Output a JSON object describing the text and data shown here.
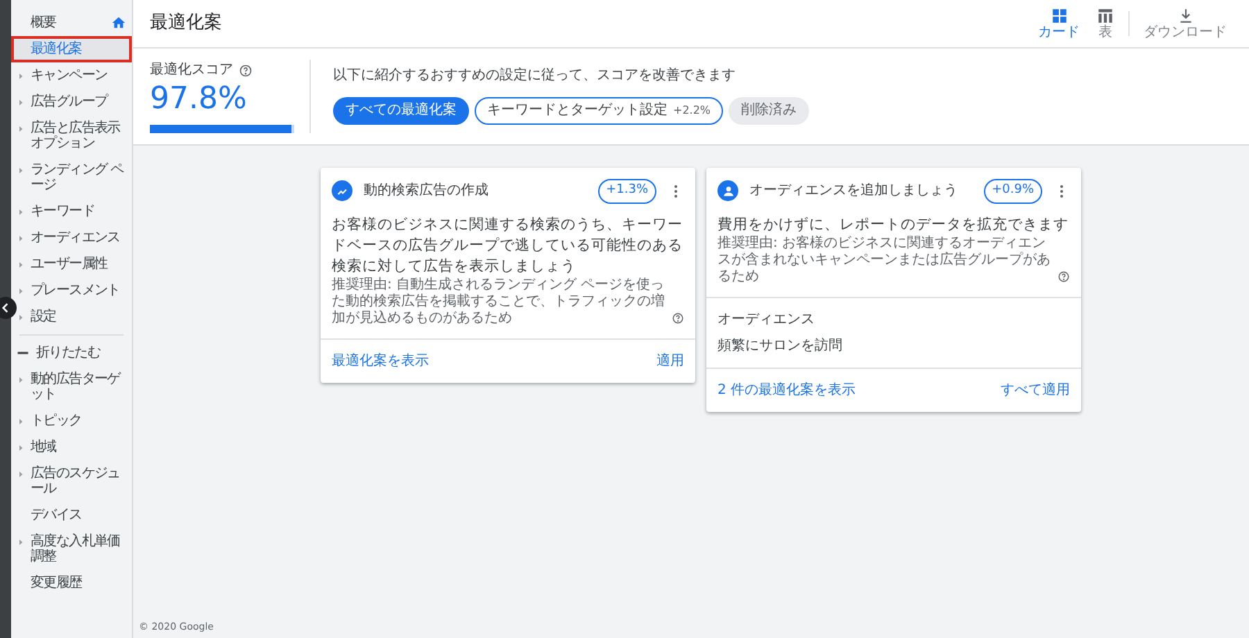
{
  "sidebar": {
    "items": [
      {
        "label": "概要",
        "kind": "home",
        "selected": false
      },
      {
        "label": "最適化案",
        "kind": "plain",
        "selected": true
      },
      {
        "label": "キャンペーン",
        "kind": "expandable",
        "selected": false
      },
      {
        "label": "広告グループ",
        "kind": "expandable",
        "selected": false
      },
      {
        "label": "広告と広告表示オプション",
        "kind": "expandable",
        "selected": false
      },
      {
        "label": "ランディング ページ",
        "kind": "expandable",
        "selected": false
      },
      {
        "label": "キーワード",
        "kind": "expandable",
        "selected": false
      },
      {
        "label": "オーディエンス",
        "kind": "expandable",
        "selected": false
      },
      {
        "label": "ユーザー属性",
        "kind": "expandable",
        "selected": false
      },
      {
        "label": "プレースメント",
        "kind": "expandable",
        "selected": false
      },
      {
        "label": "設定",
        "kind": "expandable",
        "selected": false
      },
      {
        "label": "折りたたむ",
        "kind": "collapse",
        "selected": false
      },
      {
        "label": "動的広告ターゲット",
        "kind": "expandable",
        "selected": false
      },
      {
        "label": "トピック",
        "kind": "expandable",
        "selected": false
      },
      {
        "label": "地域",
        "kind": "expandable",
        "selected": false
      },
      {
        "label": "広告のスケジュール",
        "kind": "expandable",
        "selected": false
      },
      {
        "label": "デバイス",
        "kind": "plain",
        "selected": false
      },
      {
        "label": "高度な入札単価調整",
        "kind": "expandable",
        "selected": false
      },
      {
        "label": "変更履歴",
        "kind": "plain",
        "selected": false
      }
    ]
  },
  "header": {
    "title": "最適化案",
    "toolbar": [
      {
        "label": "カード",
        "kind": "cards",
        "selected": true
      },
      {
        "label": "表",
        "kind": "table",
        "selected": false
      },
      {
        "label": "ダウンロード",
        "kind": "download",
        "selected": false
      }
    ]
  },
  "score": {
    "label": "最適化スコア",
    "value": "97.8%",
    "level": 0.978
  },
  "intro": "以下に紹介するおすすめの設定に従って、スコアを改善できます",
  "chips": [
    {
      "label": "すべての最適化案",
      "kind": "filter",
      "selected": true
    },
    {
      "label": "キーワードとターゲット設定",
      "uplift": "+2.2%",
      "kind": "filter",
      "selected": false
    },
    {
      "label": "削除済み",
      "kind": "removed",
      "selected": false
    }
  ],
  "cards": [
    {
      "kind": "trend",
      "title": "動的検索広告の作成",
      "uplift": "+1.3%",
      "headline": "お客様のビジネスに関連する検索のうち、キーワードベースの広告グループで逃している可能性のある検索に対して広告を表示しましょう",
      "reason": "推奨理由: 自動生成されるランディング ページを使った動的検索広告を掲載することで、トラフィックの増加が見込めるものがあるため",
      "link": "最適化案を表示",
      "action": "適用"
    },
    {
      "kind": "person",
      "title": "オーディエンスを追加しましょう",
      "uplift": "+0.9%",
      "headline": "費用をかけずに、レポートのデータを拡充できます",
      "reason": "推奨理由: お客様のビジネスに関連するオーディエンスが含まれないキャンペーンまたは広告グループがあるため",
      "detail": {
        "label": "オーディエンス",
        "value": "頻繁にサロンを訪問"
      },
      "link": "2 件の最適化案を表示",
      "action": "すべて適用"
    }
  ],
  "footer": "© 2020 Google"
}
